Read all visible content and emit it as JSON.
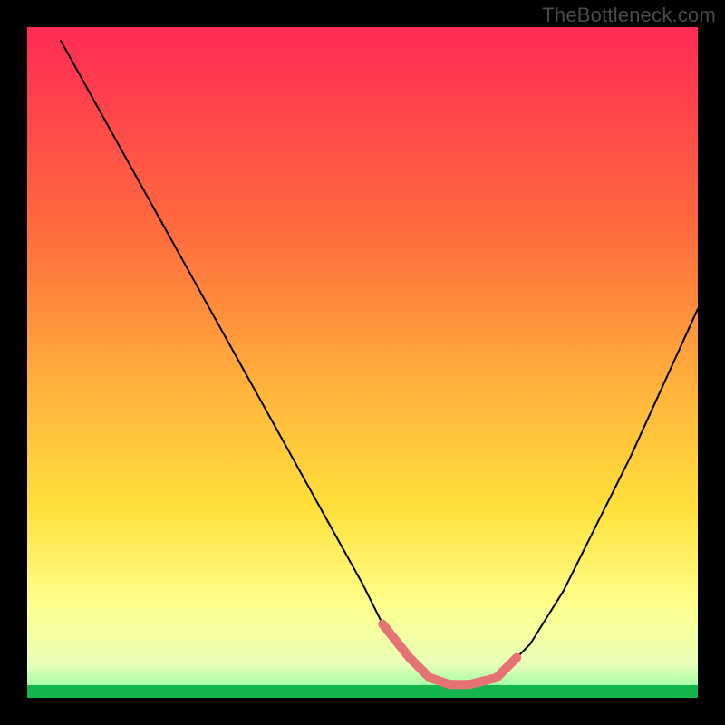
{
  "watermark": "TheBottleneck.com",
  "chart_data": {
    "type": "line",
    "title": "",
    "xlabel": "",
    "ylabel": "",
    "xlim": [
      0,
      100
    ],
    "ylim": [
      0,
      100
    ],
    "grid": false,
    "legend": false,
    "background_gradient": [
      "#ff2a55",
      "#ffd23c",
      "#ffff8c",
      "#12b64c"
    ],
    "series": [
      {
        "name": "bottleneck-curve",
        "x": [
          5,
          10,
          15,
          20,
          25,
          30,
          35,
          40,
          45,
          50,
          53,
          57,
          60,
          63,
          66,
          70,
          75,
          80,
          85,
          90,
          95,
          100
        ],
        "values": [
          98,
          89,
          80,
          71,
          62,
          53,
          44,
          35,
          26,
          17,
          11,
          6,
          3,
          2,
          2,
          3,
          8,
          16,
          26,
          36,
          47,
          58
        ]
      }
    ],
    "accent_segments": [
      {
        "name": "left-arm-highlight",
        "x": [
          53,
          57,
          60
        ],
        "values": [
          11,
          6,
          3
        ]
      },
      {
        "name": "valley-highlight",
        "x": [
          60,
          63,
          66,
          70
        ],
        "values": [
          3,
          2,
          2,
          3
        ]
      },
      {
        "name": "right-arm-highlight",
        "x": [
          70,
          73
        ],
        "values": [
          3,
          6
        ]
      }
    ]
  }
}
